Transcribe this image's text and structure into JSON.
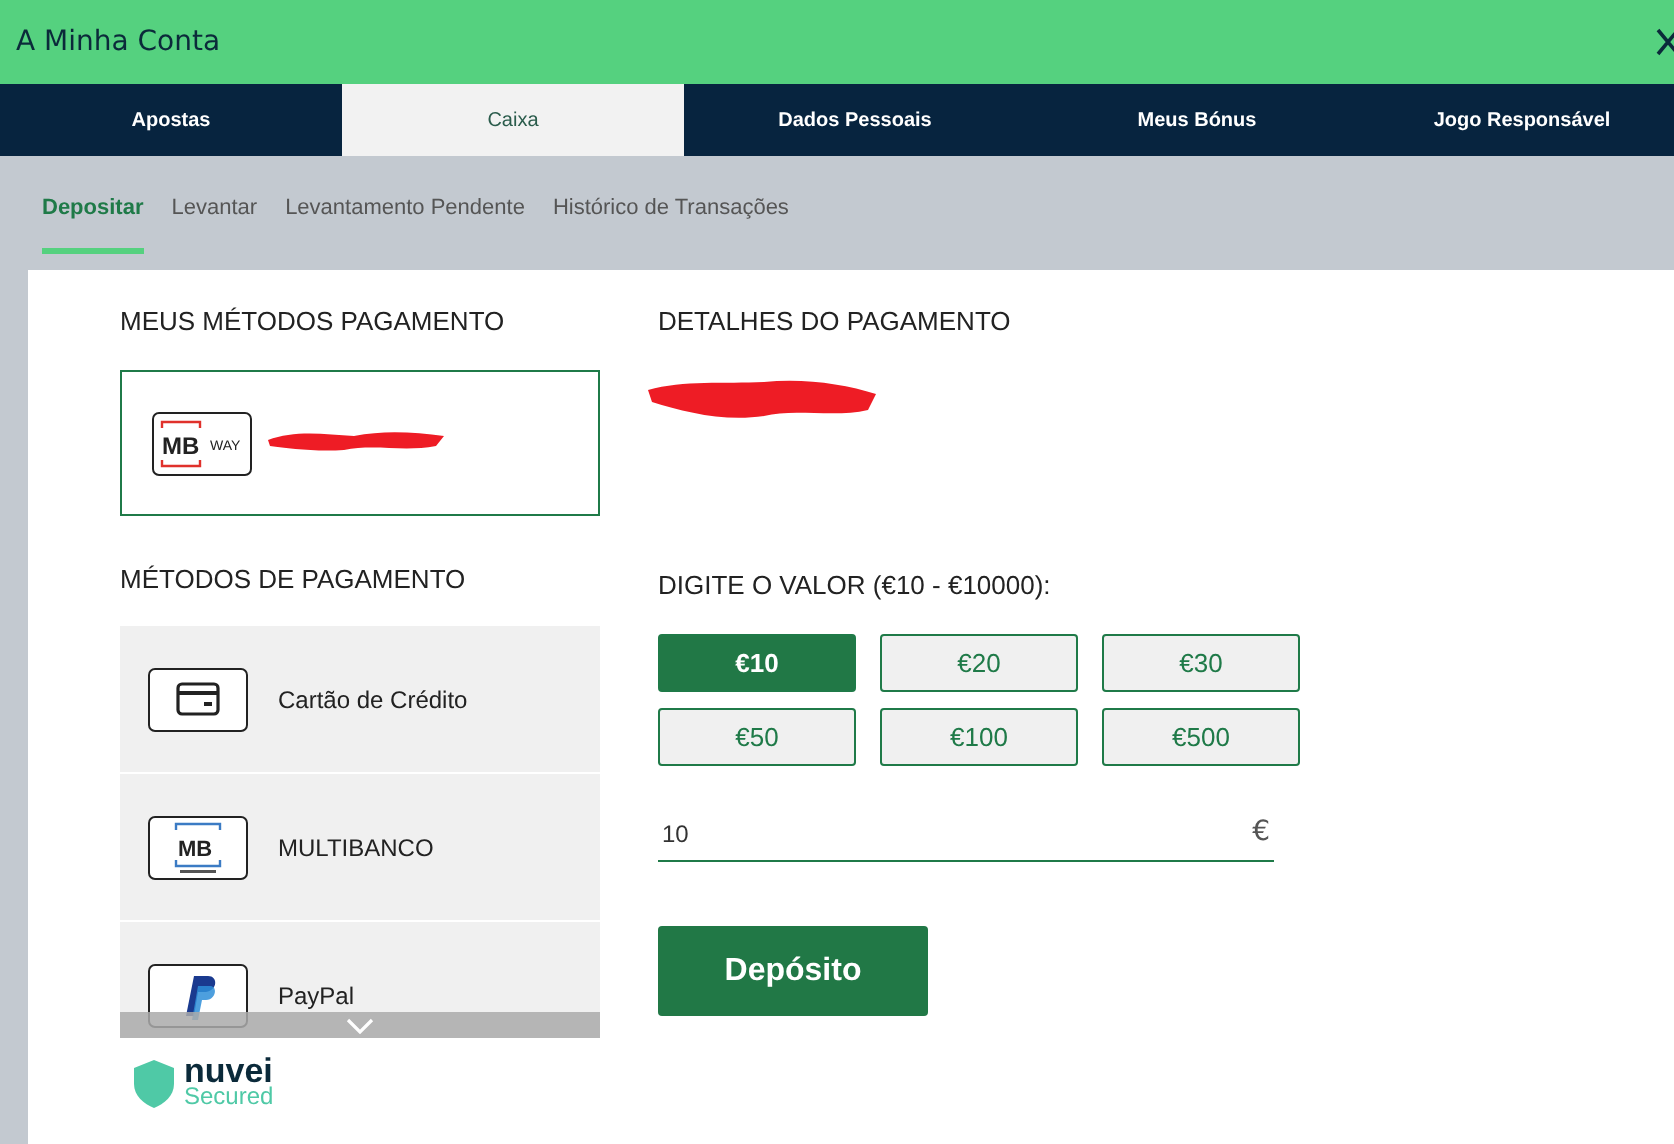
{
  "window": {
    "title": "A Minha Conta"
  },
  "tabs": [
    {
      "label": "Apostas",
      "selected": false
    },
    {
      "label": "Caixa",
      "selected": true
    },
    {
      "label": "Dados Pessoais",
      "selected": false
    },
    {
      "label": "Meus Bónus",
      "selected": false
    },
    {
      "label": "Jogo Responsável",
      "selected": false
    }
  ],
  "subtabs": [
    {
      "label": "Depositar",
      "selected": true
    },
    {
      "label": "Levantar",
      "selected": false
    },
    {
      "label": "Levantamento Pendente",
      "selected": false
    },
    {
      "label": "Histórico de Transações",
      "selected": false
    }
  ],
  "saved_methods": {
    "heading": "MEUS MÉTODOS PAGAMENTO",
    "items": [
      {
        "kind": "mbway",
        "logo": [
          "MB",
          "WAY"
        ],
        "selected": true
      }
    ]
  },
  "payment_methods": {
    "heading": "MÉTODOS DE PAGAMENTO",
    "items": [
      {
        "kind": "card",
        "label": "Cartão de Crédito"
      },
      {
        "kind": "multibanco",
        "logo": [
          "MB"
        ],
        "label": "MULTIBANCO"
      },
      {
        "kind": "paypal",
        "label": "PayPal"
      }
    ]
  },
  "security": {
    "brand": "nuvei",
    "caption": "Secured"
  },
  "details": {
    "heading": "DETALHES DO PAGAMENTO"
  },
  "amount": {
    "label": "DIGITE O VALOR (€10 - €10000):",
    "presets": [
      {
        "label": "€10",
        "selected": true
      },
      {
        "label": "€20",
        "selected": false
      },
      {
        "label": "€30",
        "selected": false
      },
      {
        "label": "€50",
        "selected": false
      },
      {
        "label": "€100",
        "selected": false
      },
      {
        "label": "€500",
        "selected": false
      }
    ],
    "value": "10",
    "currency": "€"
  },
  "submit": {
    "label": "Depósito"
  }
}
